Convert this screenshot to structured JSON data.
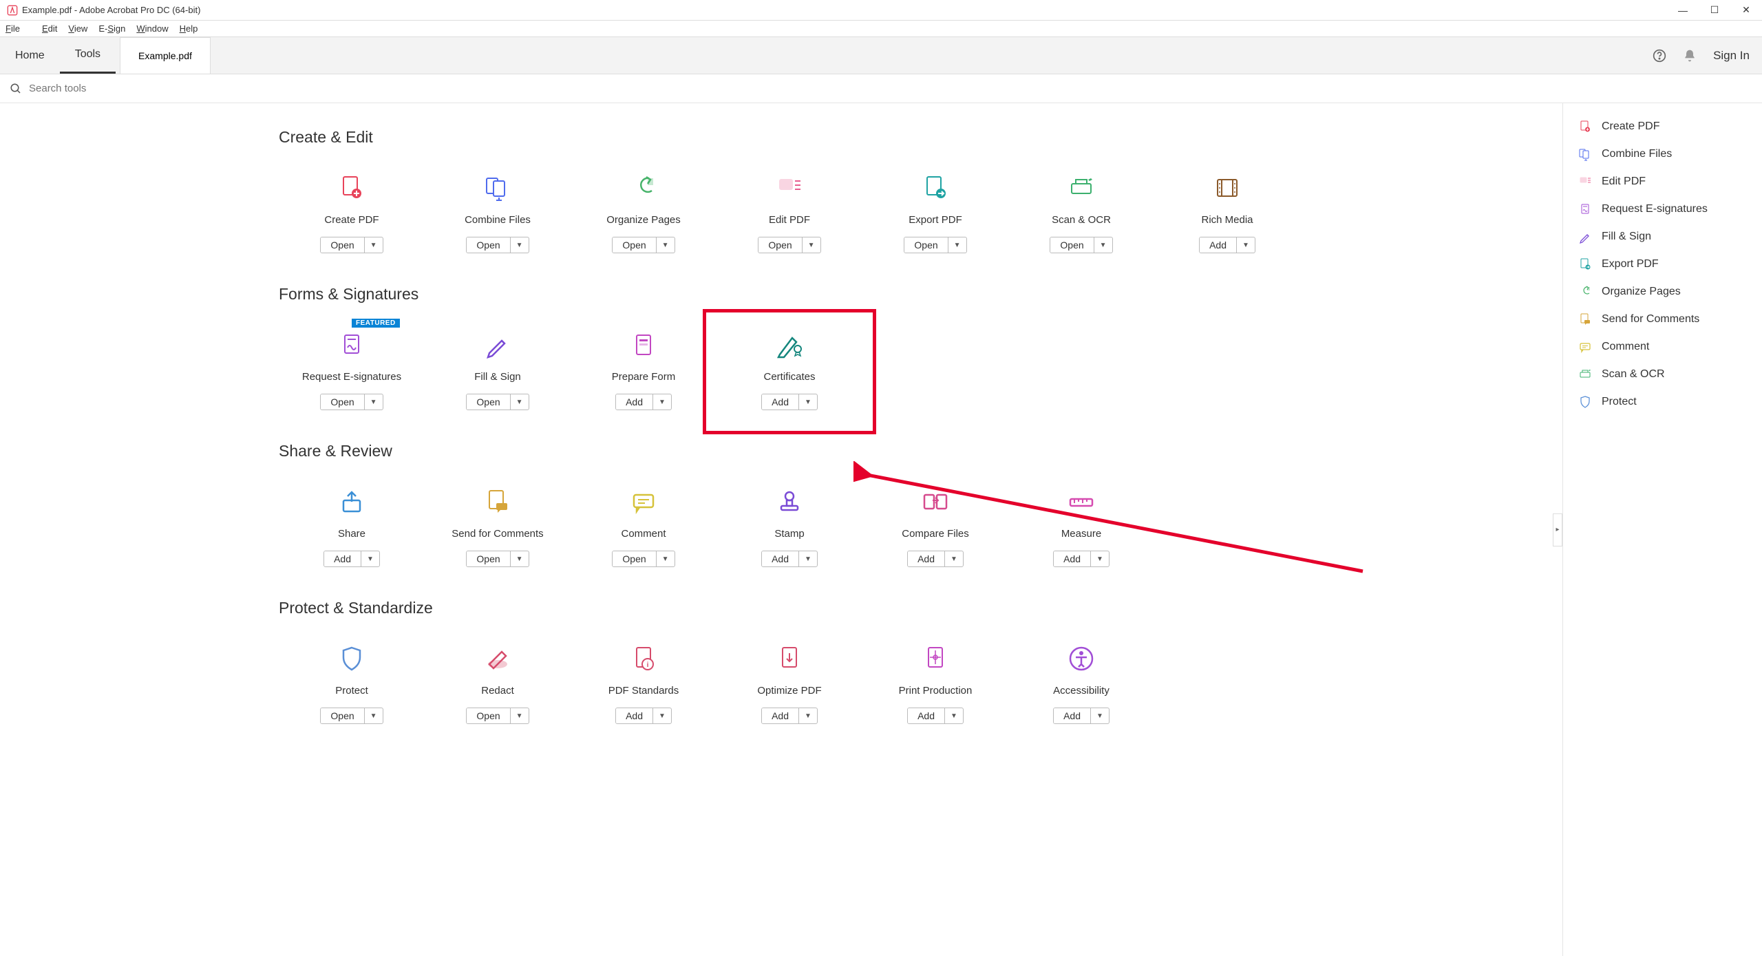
{
  "window": {
    "title": "Example.pdf - Adobe Acrobat Pro DC (64-bit)",
    "doc_name": "Example.pdf"
  },
  "menubar": [
    "File",
    "Edit",
    "View",
    "E-Sign",
    "Window",
    "Help"
  ],
  "header": {
    "tab_home": "Home",
    "tab_tools": "Tools",
    "signin": "Sign In"
  },
  "search": {
    "placeholder": "Search tools"
  },
  "sections": {
    "create_edit": {
      "title": "Create & Edit",
      "tools": [
        {
          "label": "Create PDF",
          "action": "Open",
          "icon_color": "#e8435a"
        },
        {
          "label": "Combine Files",
          "action": "Open",
          "icon_color": "#4f6bed"
        },
        {
          "label": "Organize Pages",
          "action": "Open",
          "icon_color": "#47b36a"
        },
        {
          "label": "Edit PDF",
          "action": "Open",
          "icon_color": "#e85c8e"
        },
        {
          "label": "Export PDF",
          "action": "Open",
          "icon_color": "#1fa3a3"
        },
        {
          "label": "Scan & OCR",
          "action": "Open",
          "icon_color": "#3cb06e"
        },
        {
          "label": "Rich Media",
          "action": "Add",
          "icon_color": "#8b5a2b"
        }
      ]
    },
    "forms_signatures": {
      "title": "Forms & Signatures",
      "tools": [
        {
          "label": "Request E-signatures",
          "action": "Open",
          "icon_color": "#a14ed6",
          "badge": "FEATURED"
        },
        {
          "label": "Fill & Sign",
          "action": "Open",
          "icon_color": "#7a4bd6"
        },
        {
          "label": "Prepare Form",
          "action": "Add",
          "icon_color": "#c247c2"
        },
        {
          "label": "Certificates",
          "action": "Add",
          "icon_color": "#14867d",
          "highlighted": true
        }
      ]
    },
    "share_review": {
      "title": "Share & Review",
      "tools": [
        {
          "label": "Share",
          "action": "Add",
          "icon_color": "#3a8fd6"
        },
        {
          "label": "Send for Comments",
          "action": "Open",
          "icon_color": "#d6a53a"
        },
        {
          "label": "Comment",
          "action": "Open",
          "icon_color": "#d6c23a"
        },
        {
          "label": "Stamp",
          "action": "Add",
          "icon_color": "#7a4bd6"
        },
        {
          "label": "Compare Files",
          "action": "Add",
          "icon_color": "#d64b8e"
        },
        {
          "label": "Measure",
          "action": "Add",
          "icon_color": "#d64bb0"
        }
      ]
    },
    "protect_standardize": {
      "title": "Protect & Standardize",
      "tools": [
        {
          "label": "Protect",
          "action": "Open",
          "icon_color": "#5a8fd6"
        },
        {
          "label": "Redact",
          "action": "Open",
          "icon_color": "#d64b6b"
        },
        {
          "label": "PDF Standards",
          "action": "Add",
          "icon_color": "#d64b6b"
        },
        {
          "label": "Optimize PDF",
          "action": "Add",
          "icon_color": "#d64b6b"
        },
        {
          "label": "Print Production",
          "action": "Add",
          "icon_color": "#c247c2"
        },
        {
          "label": "Accessibility",
          "action": "Add",
          "icon_color": "#a14ed6"
        }
      ]
    }
  },
  "rightrail": [
    {
      "label": "Create PDF",
      "color": "#e8435a"
    },
    {
      "label": "Combine Files",
      "color": "#4f6bed"
    },
    {
      "label": "Edit PDF",
      "color": "#e85c8e"
    },
    {
      "label": "Request E-signatures",
      "color": "#a14ed6"
    },
    {
      "label": "Fill & Sign",
      "color": "#7a4bd6"
    },
    {
      "label": "Export PDF",
      "color": "#1fa3a3"
    },
    {
      "label": "Organize Pages",
      "color": "#47b36a"
    },
    {
      "label": "Send for Comments",
      "color": "#d6a53a"
    },
    {
      "label": "Comment",
      "color": "#d6c23a"
    },
    {
      "label": "Scan & OCR",
      "color": "#3cb06e"
    },
    {
      "label": "Protect",
      "color": "#5a8fd6"
    }
  ]
}
